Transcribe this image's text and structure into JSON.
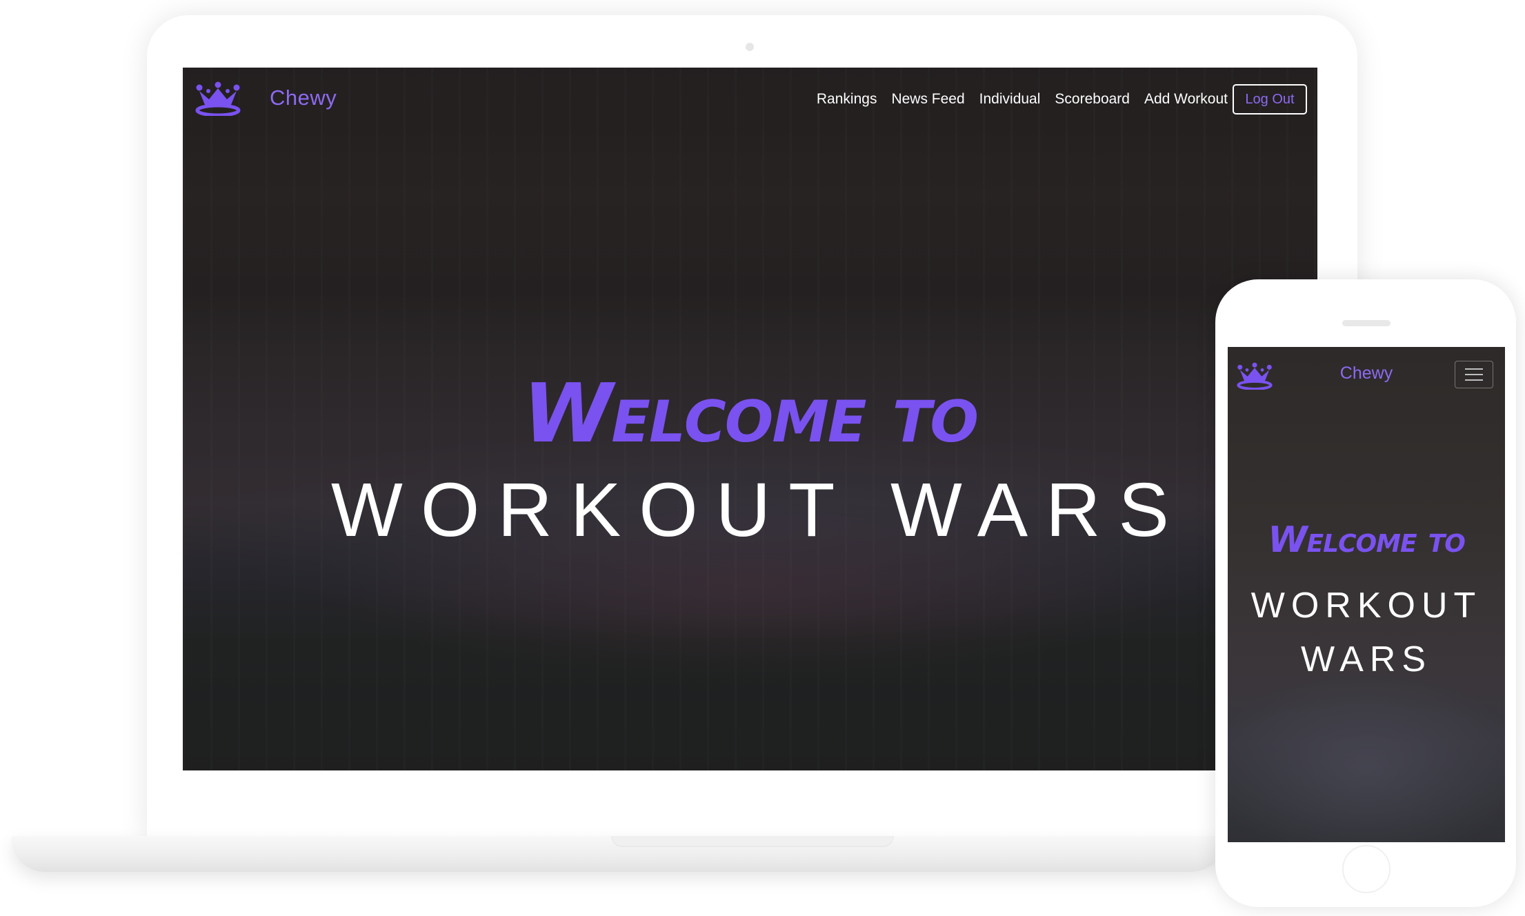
{
  "desktop": {
    "brand": "Chewy",
    "nav": [
      "Rankings",
      "News Feed",
      "Individual",
      "Scoreboard",
      "Add Workout"
    ],
    "logout_label": "Log Out",
    "hero": {
      "welcome": "Welcome to",
      "title": "WORKOUT WARS"
    }
  },
  "mobile": {
    "brand": "Chewy",
    "hero": {
      "welcome": "Welcome to",
      "title_line1": "WORKOUT",
      "title_line2": "WARS"
    }
  },
  "colors": {
    "accent": "#8d6af2",
    "hero_purple": "#7a52f0",
    "text": "#ffffff"
  },
  "icons": {
    "logo": "crown-icon",
    "menu": "hamburger-menu-icon"
  }
}
